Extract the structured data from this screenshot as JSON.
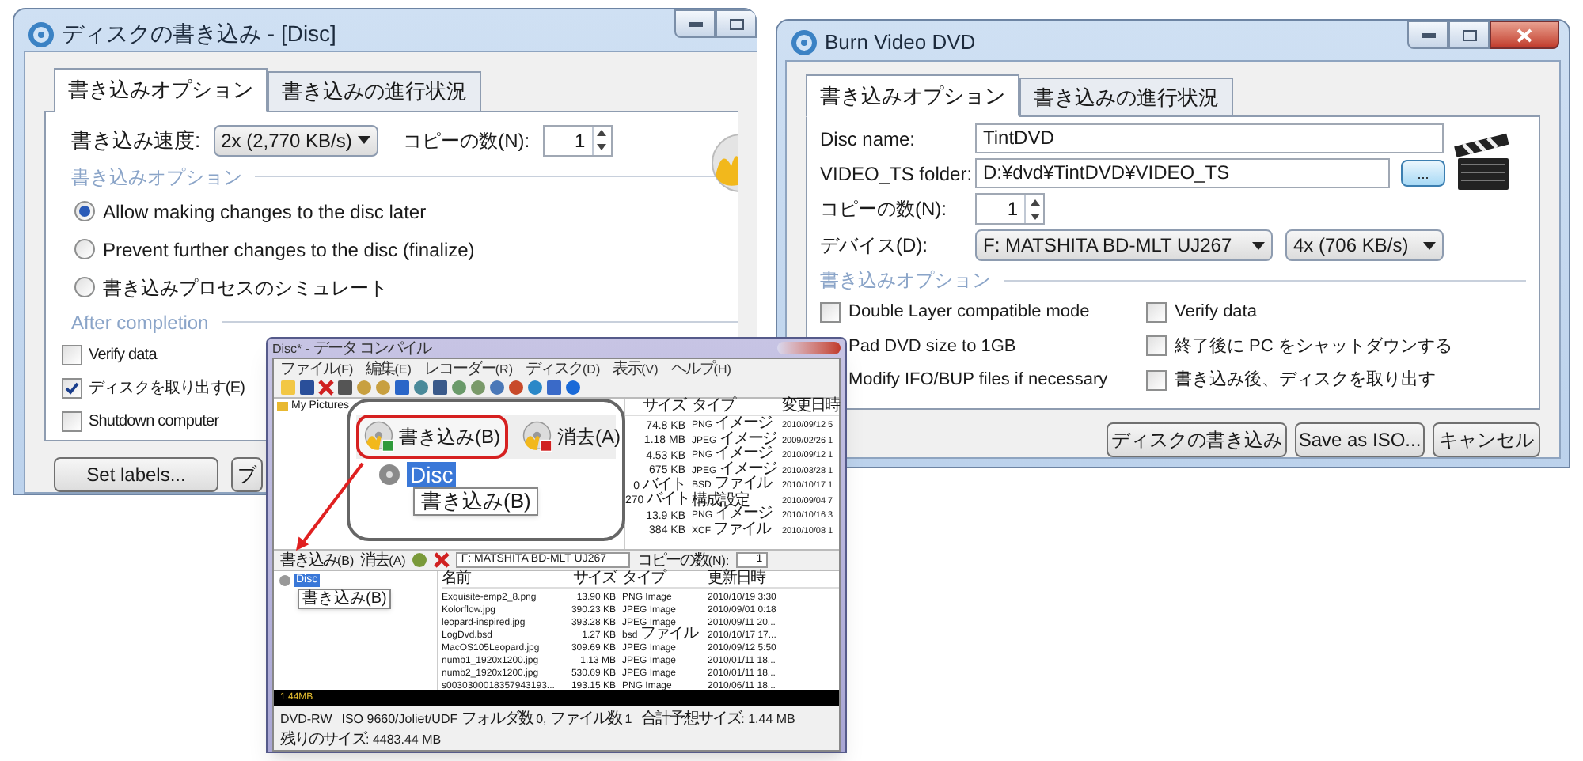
{
  "write_disc_window": {
    "title": "ディスクの書き込み - [Disc]",
    "tabs": [
      {
        "label": "書き込みオプション",
        "selected": true
      },
      {
        "label": "書き込みの進行状況",
        "selected": false
      }
    ],
    "speed_label": "書き込み速度:",
    "speed_value": "2x (2,770 KB/s)",
    "copies_label": "コピーの数(N):",
    "copies_value": "1",
    "options_heading": "書き込みオプション",
    "radios": [
      {
        "label": "Allow making changes to the disc later",
        "selected": true
      },
      {
        "label": "Prevent further changes to the disc (finalize)",
        "selected": false
      },
      {
        "label": "書き込みプロセスのシミュレート",
        "selected": false
      }
    ],
    "after_heading": "After completion",
    "checkboxes": [
      {
        "label": "Verify data",
        "checked": false
      },
      {
        "label": "ディスクを取り出す(E)",
        "checked": true
      },
      {
        "label": "Shutdown computer",
        "checked": false
      }
    ],
    "buttons": [
      "Set labels...",
      "ブ"
    ]
  },
  "burn_video_window": {
    "title": "Burn Video DVD",
    "tabs": [
      {
        "label": "書き込みオプション",
        "selected": true
      },
      {
        "label": "書き込みの進行状況",
        "selected": false
      }
    ],
    "disc_name_label": "Disc name:",
    "disc_name_value": "TintDVD",
    "folder_label": "VIDEO_TS folder:",
    "folder_value": "D:¥dvd¥TintDVD¥VIDEO_TS",
    "browse_button": "...",
    "copies_label": "コピーの数(N):",
    "copies_value": "1",
    "device_label": "デバイス(D):",
    "device_value": "F: MATSHITA BD-MLT UJ267",
    "speed_value": "4x (706 KB/s)",
    "options_heading": "書き込みオプション",
    "left_options": [
      {
        "label": "Double Layer compatible mode",
        "checked": false
      },
      {
        "label": "Pad DVD size to 1GB"
      },
      {
        "label": "Modify IFO/BUP files if necessary"
      }
    ],
    "right_options": [
      {
        "label": "Verify data",
        "checked": false
      },
      {
        "label": "終了後に PC をシャットダウンする",
        "checked": false
      },
      {
        "label": "書き込み後、ディスクを取り出す",
        "checked": false
      }
    ],
    "buttons": [
      "ディスクの書き込み",
      "Save as ISO...",
      "キャンセル"
    ]
  },
  "data_compile_window": {
    "title": "Disc* - データ コンパイル",
    "menu": [
      "ファイル(F)",
      "編集(E)",
      "レコーダー(R)",
      "ディスク(D)",
      "表示(V)",
      "ヘルプ(H)"
    ],
    "tree_header": "My Pictures",
    "upper_list": {
      "columns": [
        "サイズ",
        "タイプ",
        "変更日時"
      ],
      "rows": [
        [
          "74.8 KB",
          "PNG イメージ",
          "2010/09/12 5"
        ],
        [
          "1.18 MB",
          "JPEG イメージ",
          "2009/02/26 1"
        ],
        [
          "4.53 KB",
          "PNG イメージ",
          "2010/09/12 1"
        ],
        [
          "675 KB",
          "JPEG イメージ",
          "2010/03/28 1"
        ],
        [
          "0 バイト",
          "BSD ファイル",
          "2010/10/17 1"
        ],
        [
          "270 バイト",
          "構成設定",
          "2010/09/04 7"
        ],
        [
          "13.9 KB",
          "PNG イメージ",
          "2010/10/16 3"
        ],
        [
          "384 KB",
          "XCF ファイル",
          "2010/10/08 1"
        ]
      ]
    },
    "callout": {
      "buttons": [
        {
          "label": "書き込み(B)",
          "highlighted": true
        },
        {
          "label": "消去(A)",
          "highlighted": false
        }
      ],
      "tree_item": {
        "label": "Disc",
        "selected": true
      },
      "tooltip": "書き込み(B)"
    },
    "toolbar": {
      "buttons": [
        "書き込み(B)",
        "消去(A)"
      ],
      "drive": "F: MATSHITA BD-MLT UJ267",
      "copies_label": "コピーの数(N):",
      "copies_value": "1"
    },
    "tree_item": {
      "label": "Disc",
      "selected": true
    },
    "tooltip": "書き込み(B)",
    "file_list": {
      "columns": [
        "名前",
        "サイズ",
        "タイプ",
        "更新日時"
      ],
      "rows": [
        [
          "Exquisite-emp2_8.png",
          "13.90 KB",
          "PNG Image",
          "2010/10/19 3:30"
        ],
        [
          "Kolorflow.jpg",
          "390.23 KB",
          "JPEG Image",
          "2010/09/01 0:18"
        ],
        [
          "leopard-inspired.jpg",
          "393.28 KB",
          "JPEG Image",
          "2010/09/11 20..."
        ],
        [
          "LogDvd.bsd",
          "1.27 KB",
          "bsd ファイル",
          "2010/10/17 17..."
        ],
        [
          "MacOS105Leopard.jpg",
          "309.69 KB",
          "JPEG Image",
          "2010/09/12 5:50"
        ],
        [
          "numb1_1920x1200.jpg",
          "1.13 MB",
          "JPEG Image",
          "2010/01/11 18..."
        ],
        [
          "numb2_1920x1200.jpg",
          "530.69 KB",
          "JPEG Image",
          "2010/01/11 18..."
        ],
        [
          "s0030300018357943193...",
          "193.15 KB",
          "PNG Image",
          "2010/06/11 18..."
        ]
      ]
    },
    "capacity": "1.44MB",
    "status_bar": [
      "DVD-RW",
      "ISO 9660/Joliet/UDF フォルダ数 0, ファイル数 1",
      "合計予想サイズ: 1.44 MB",
      "残りのサイズ: 4483.44 MB"
    ]
  }
}
